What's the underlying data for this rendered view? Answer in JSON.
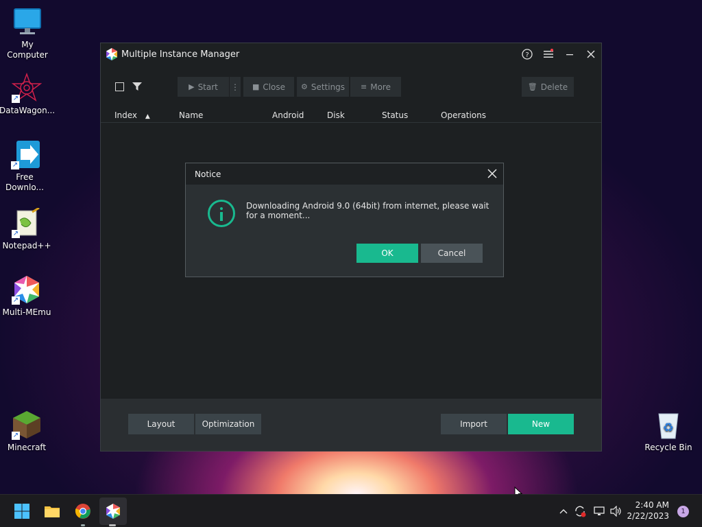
{
  "desktop": {
    "icons": [
      {
        "label": "My Computer",
        "icon": "computer-monitor-icon"
      },
      {
        "label": "DataWagon...",
        "icon": "datawagon-icon"
      },
      {
        "label": "Free Downlo...",
        "icon": "free-download-manager-icon"
      },
      {
        "label": "Notepad++",
        "icon": "notepad-plus-plus-icon"
      },
      {
        "label": "Multi-MEmu",
        "icon": "multi-memu-icon"
      },
      {
        "label": "Minecraft",
        "icon": "minecraft-icon"
      },
      {
        "label": "Recycle Bin",
        "icon": "recycle-bin-icon"
      }
    ]
  },
  "window": {
    "title": "Multiple Instance Manager",
    "toolbar": {
      "start": "Start",
      "close": "Close",
      "settings": "Settings",
      "more": "More",
      "delete": "Delete"
    },
    "columns": [
      "Index",
      "Name",
      "Android",
      "Disk",
      "Status",
      "Operations"
    ],
    "footer": {
      "layout": "Layout",
      "optimization": "Optimization",
      "import": "Import",
      "new": "New"
    }
  },
  "dialog": {
    "title": "Notice",
    "message": "Downloading Android 9.0 (64bit) from internet, please wait for a moment...",
    "ok": "OK",
    "cancel": "Cancel"
  },
  "taskbar": {
    "time": "2:40 AM",
    "date": "2/22/2023",
    "notifications": "1"
  },
  "colors": {
    "accent": "#19b98f",
    "window_bg": "#1d2022",
    "footer_bg": "#2a2e31",
    "button_gray": "#3b4449"
  }
}
